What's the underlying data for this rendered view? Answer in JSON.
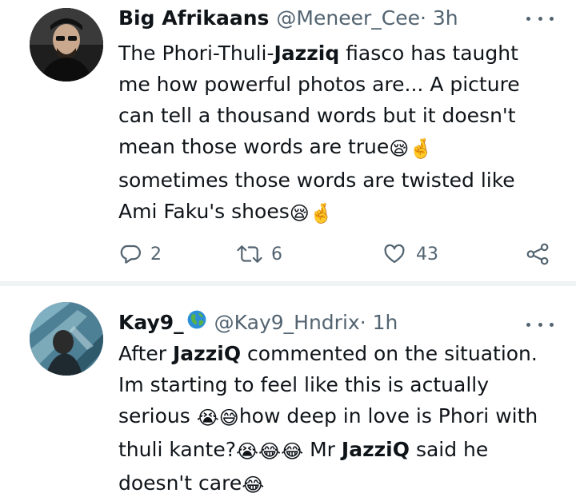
{
  "tweets": [
    {
      "name": "Big Afrikaans",
      "handle": "@Meneer_Cee",
      "time": " · 3h",
      "lines": [
        [
          {
            "t": "The Phori-Thuli-"
          },
          {
            "t": "Jazziq",
            "b": true
          },
          {
            "t": " fiasco has taught"
          }
        ],
        [
          {
            "t": "me how powerful photos are... A picture"
          }
        ],
        [
          {
            "t": "can tell a thousand words but it doesn't"
          }
        ],
        [
          {
            "t": "mean those words are true"
          },
          {
            "t": "😪🤞",
            "e": true
          }
        ],
        [
          {
            "t": "sometimes those words are twisted like"
          }
        ],
        [
          {
            "t": "Ami Faku's shoes"
          },
          {
            "t": "😪🤞",
            "e": true
          }
        ]
      ],
      "replies": "2",
      "retweets": "6",
      "likes": "43"
    },
    {
      "name": "Kay9_",
      "handle": "@Kay9_Hndrix",
      "time": " · 1h",
      "lines": [
        [
          {
            "t": "After "
          },
          {
            "t": "JazziQ",
            "b": true
          },
          {
            "t": " commented on the situation."
          }
        ],
        [
          {
            "t": "Im starting to feel like this is actually"
          }
        ],
        [
          {
            "t": "serious "
          },
          {
            "t": "😭😅",
            "e": true
          },
          {
            "t": "how deep in love is Phori with"
          }
        ],
        [
          {
            "t": "thuli kante?"
          },
          {
            "t": "😭😂😂",
            "e": true
          },
          {
            "t": " Mr "
          },
          {
            "t": "JazziQ",
            "b": true
          },
          {
            "t": " said he"
          }
        ],
        [
          {
            "t": "doesn't care"
          },
          {
            "t": "😂",
            "e": true
          }
        ]
      ]
    }
  ],
  "icons": {
    "reply": "comment-icon",
    "retweet": "retweet-icon",
    "like": "heart-icon",
    "share": "share-icon",
    "more": "more-icon",
    "globe": "globe-icon"
  },
  "colors": {
    "text": "#0f1419",
    "muted": "#536471",
    "divider": "#eff3f4"
  }
}
